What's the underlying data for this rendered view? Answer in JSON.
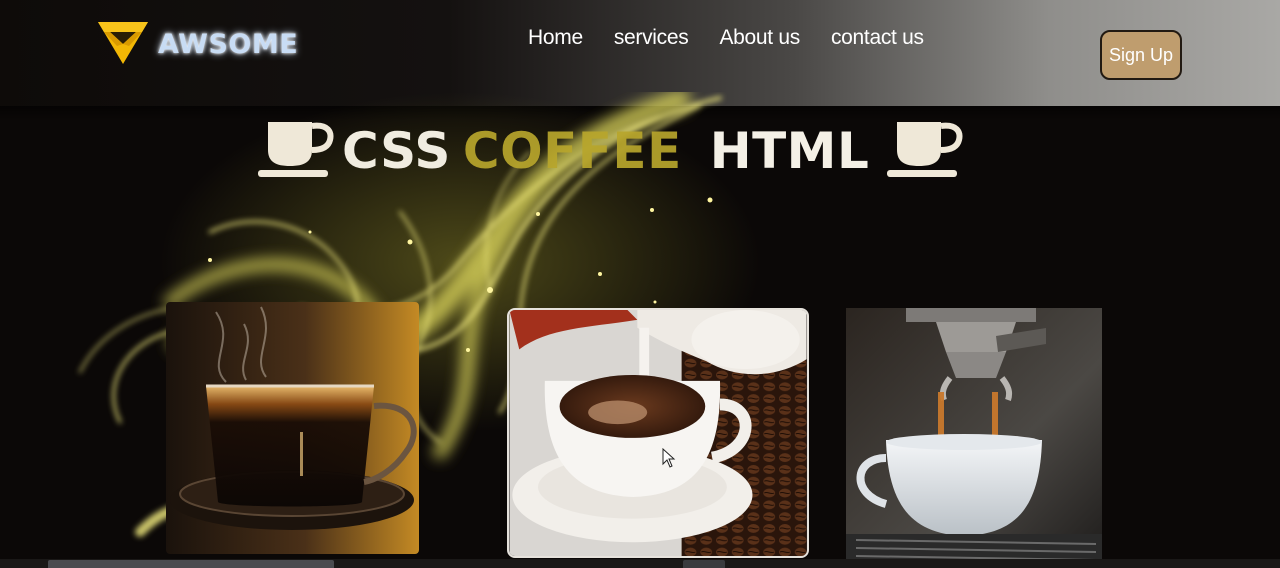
{
  "brand": {
    "name": "AWSOME",
    "icon": "diamond-icon",
    "color": "#f2b705"
  },
  "nav": {
    "items": [
      {
        "label": "Home"
      },
      {
        "label": "services"
      },
      {
        "label": "About us"
      },
      {
        "label": "contact us"
      }
    ]
  },
  "header": {
    "signup_label": "Sign Up",
    "signup_color": "#bf9d6e"
  },
  "hero": {
    "words": [
      "CSS",
      "COFFEE",
      "HTML"
    ],
    "icon": "coffee-cup-icon",
    "accent": "#b8a62c"
  },
  "gallery": {
    "images": [
      {
        "name": "glass-coffee-cup-photo"
      },
      {
        "name": "milk-pouring-coffee-photo"
      },
      {
        "name": "espresso-machine-photo"
      }
    ]
  }
}
